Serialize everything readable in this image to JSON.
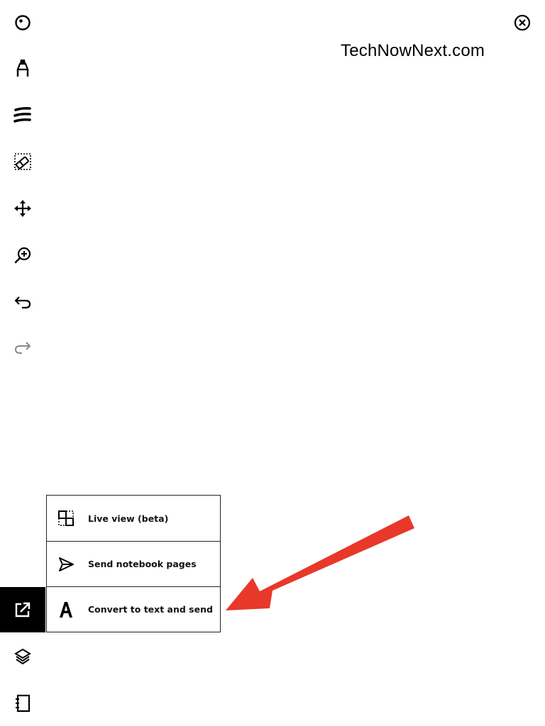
{
  "watermark": "TechNowNext.com",
  "toolbar": {
    "items": [
      {
        "name": "pen-settings",
        "icon": "circle-dot-icon"
      },
      {
        "name": "marker",
        "icon": "marker-icon"
      },
      {
        "name": "brush-stroke",
        "icon": "stroke-icon"
      },
      {
        "name": "eraser",
        "icon": "eraser-icon"
      },
      {
        "name": "move",
        "icon": "move-icon"
      },
      {
        "name": "zoom",
        "icon": "zoom-in-icon"
      },
      {
        "name": "undo",
        "icon": "undo-icon"
      },
      {
        "name": "redo",
        "icon": "redo-icon"
      },
      {
        "name": "share",
        "icon": "share-icon",
        "active": true
      },
      {
        "name": "layers",
        "icon": "layers-icon"
      },
      {
        "name": "notebook",
        "icon": "notebook-icon"
      }
    ]
  },
  "share_menu": {
    "items": [
      {
        "label": "Live view (beta)",
        "icon": "live-view-icon"
      },
      {
        "label": "Send notebook pages",
        "icon": "send-icon"
      },
      {
        "label": "Convert to text and send",
        "icon": "letter-a-icon"
      }
    ]
  },
  "colors": {
    "accent_arrow": "#e8382a",
    "active_bg": "#000000"
  }
}
